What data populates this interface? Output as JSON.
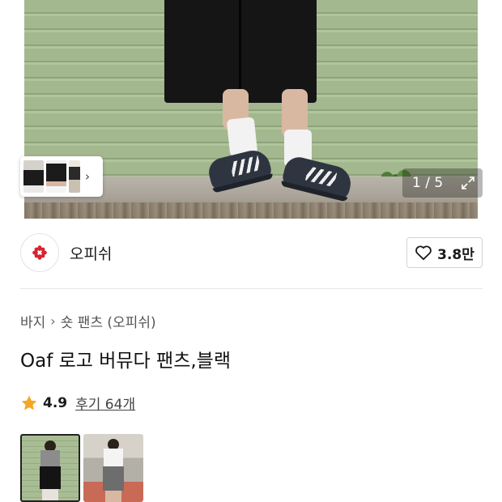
{
  "gallery": {
    "counter": "1 / 5"
  },
  "brand": {
    "name": "오피쉬",
    "like_count": "3.8만"
  },
  "breadcrumb": {
    "category": "바지",
    "subcategory": "숏 팬츠 (오피쉬)"
  },
  "product": {
    "title": "Oaf 로고 버뮤다 팬츠,블랙",
    "rating": "4.9",
    "review_label": "후기 64개"
  },
  "colors": {
    "star": "#f5a623",
    "logo_red": "#d9232e",
    "selected_border": "#222222"
  }
}
